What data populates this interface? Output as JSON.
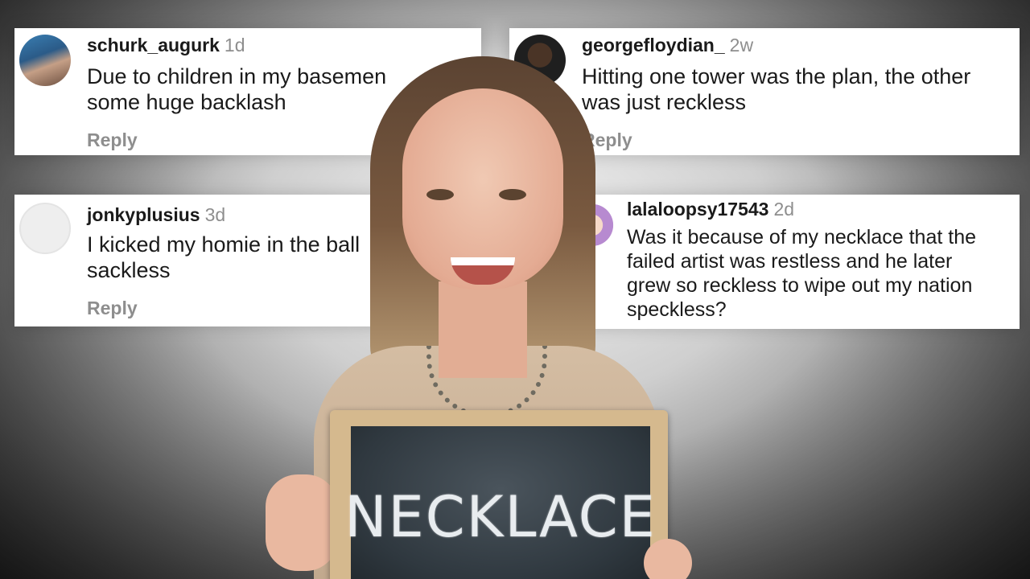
{
  "comments": [
    {
      "username": "schurk_augurk",
      "age": "1d",
      "text_lines": [
        "Due to children in my basemen",
        "some huge backlash"
      ],
      "reply": "Reply"
    },
    {
      "username": "georgefloydian_",
      "age": "2w",
      "text_lines": [
        "Hitting one tower was the plan, the other",
        "was just reckless"
      ],
      "reply": "Reply"
    },
    {
      "username": "jonkyplusius",
      "age": "3d",
      "text_lines": [
        "I kicked my homie in the ball",
        "sackless"
      ],
      "reply": "Reply"
    },
    {
      "username": "lalaloopsy17543",
      "age": "2d",
      "text_lines": [
        "Was it because of my necklace that the",
        "failed artist was restless and he later",
        "grew so reckless to wipe out my nation",
        "speckless?"
      ]
    }
  ],
  "chalkboard": {
    "word": "NECKLACE"
  }
}
